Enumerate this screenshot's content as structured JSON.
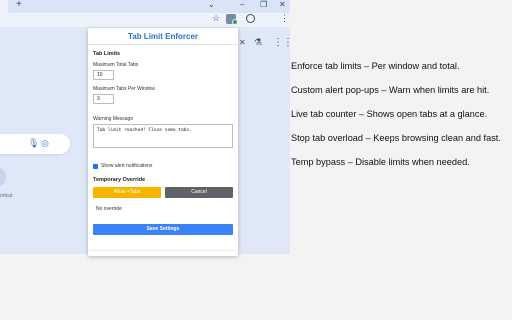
{
  "browser": {
    "new_tab_icon": "+",
    "chevron_icon": "chevron-down",
    "window_controls": [
      "–",
      "❐",
      "✕"
    ],
    "bookmark_icon": "star",
    "menu_icon": "⋮",
    "shortcut_text": "ortcut"
  },
  "popup": {
    "title": "Tab Limit Enforcer",
    "tab_limits_heading": "Tab Limits",
    "max_total_label": "Maximum Total Tabs",
    "max_total_value": "10",
    "max_per_window_label": "Maximum Tabs Per Window",
    "max_per_window_value": "3",
    "warning_label": "Warning Message",
    "warning_value": "Tab limit reached! Close some tabs.",
    "show_alert_label": "Show alert notifications",
    "show_alert_checked": true,
    "override_heading": "Temporary Override",
    "allow_button": "Allow +Tabs",
    "cancel_button": "Cancel",
    "override_status": "No override",
    "save_button": "Save Settings"
  },
  "features": [
    "Enforce tab limits – Per window and total.",
    "Custom alert pop-ups – Warn when limits are hit.",
    "Live tab counter – Shows open tabs at a glance.",
    "Stop tab overload – Keeps browsing clean and fast.",
    "Temp bypass – Disable limits when needed."
  ],
  "colors": {
    "accent": "#2a6fd6",
    "allow": "#f4b400",
    "cancel": "#5f6368",
    "save": "#3b82f6",
    "page_bg": "#dfe8f7"
  }
}
